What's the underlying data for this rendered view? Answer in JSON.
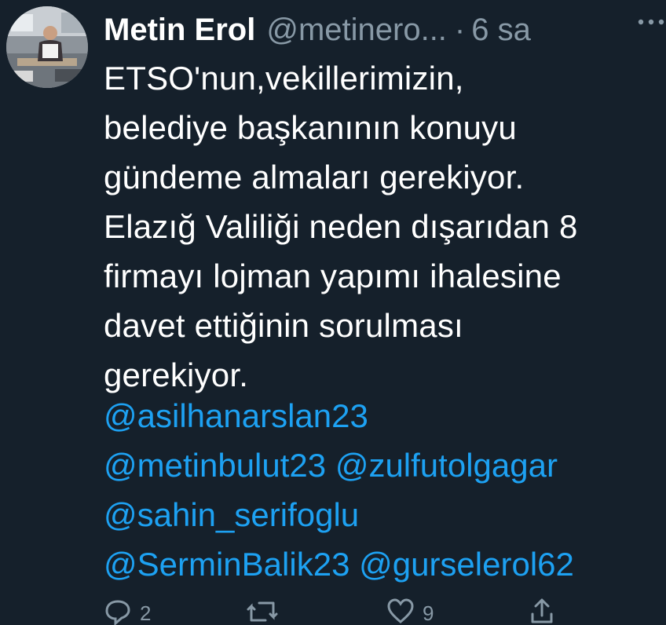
{
  "tweet": {
    "display_name": "Metin Erol",
    "handle": "@metinero...",
    "separator": "·",
    "time": "6 sa",
    "body_lines": [
      "ETSO'nun,vekillerimizin,",
      "belediye başkanının konuyu",
      "gündeme almaları gerekiyor.",
      "Elazığ Valiliği neden dışarıdan 8",
      "firmayı lojman yapımı ihalesine",
      "davet ettiğinin sorulması",
      "gerekiyor."
    ],
    "mentions": {
      "m1": "@asilhanarslan23",
      "m2": "@metinbulut23",
      "m3": "@zulfutolgagar",
      "m4": "@sahin_serifoglu",
      "m5": "@SerminBalik23",
      "m6": "@gurselerol62"
    },
    "actions": {
      "reply_count": "2",
      "like_count": "9"
    }
  },
  "icons": {
    "more": "more-icon",
    "reply": "reply-icon",
    "retweet": "retweet-icon",
    "like": "like-icon",
    "share": "share-icon"
  },
  "colors": {
    "background": "#15202b",
    "text": "#ffffff",
    "secondary": "#8899a6",
    "link": "#1da1f2"
  }
}
